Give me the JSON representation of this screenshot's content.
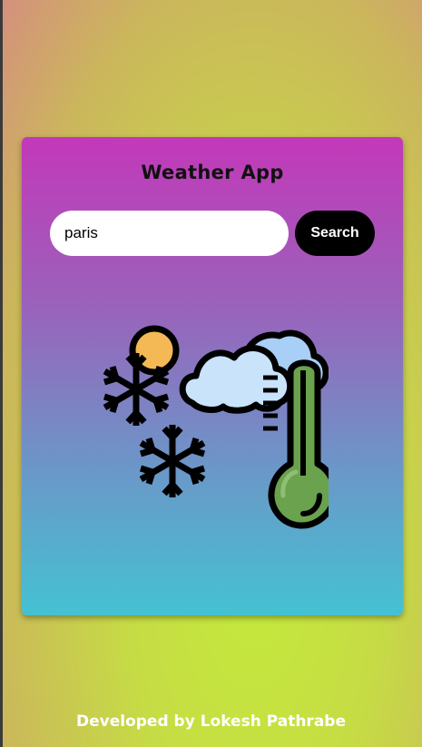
{
  "app": {
    "title": "Weather App"
  },
  "search": {
    "value": "paris",
    "button_label": "Search"
  },
  "weather": {
    "icon": "snow-cloud-thermometer-icon"
  },
  "footer": {
    "text": "Developed by Lokesh Pathrabe"
  },
  "colors": {
    "card_top": "#c338b9",
    "card_bottom": "#44c2d2",
    "button": "#000000",
    "footer_text": "#ffffff"
  }
}
